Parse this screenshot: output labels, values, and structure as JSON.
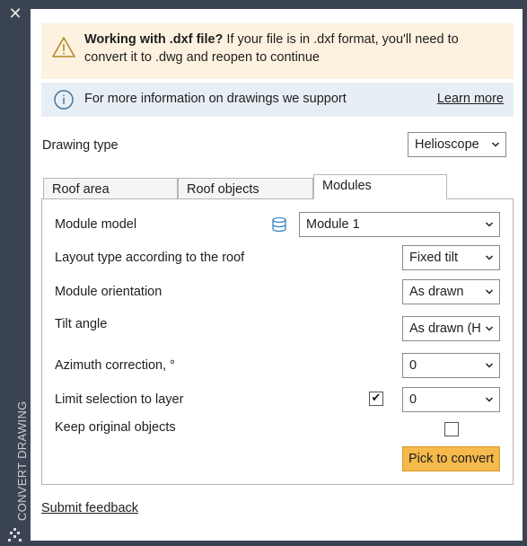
{
  "window": {
    "close_glyph": "✕",
    "vertical_title": "CONVERT DRAWING"
  },
  "warning": {
    "bold": "Working with .dxf file?",
    "text": " If your file is in .dxf format, you'll need to convert it to .dwg and reopen to continue",
    "icon": "warning-triangle-icon",
    "color": "#fdf2df"
  },
  "info": {
    "text": "For more information on drawings we support",
    "link": "Learn more",
    "icon": "info-circle-icon"
  },
  "drawing_type": {
    "label": "Drawing type",
    "value": "Helioscope"
  },
  "tabs": [
    {
      "label": "Roof area",
      "active": false
    },
    {
      "label": "Roof objects",
      "active": false
    },
    {
      "label": "Modules",
      "active": true
    }
  ],
  "fields": {
    "module_model": {
      "label": "Module model",
      "value": "Module 1"
    },
    "layout_type": {
      "label": "Layout type according to the roof",
      "value": "Fixed tilt"
    },
    "orientation": {
      "label": "Module orientation",
      "value": "As drawn"
    },
    "tilt": {
      "label": "Tilt angle",
      "value": "As drawn (H"
    },
    "azimuth": {
      "label": "Azimuth correction, °",
      "value": "0"
    },
    "limit_layer": {
      "label": "Limit selection to layer",
      "value": "0",
      "checked": true,
      "check_glyph": "✔"
    },
    "keep_original": {
      "label": "Keep original objects",
      "checked": false
    }
  },
  "actions": {
    "pick_label": "Pick to convert",
    "pick_color": "#f6b94b"
  },
  "footer": {
    "feedback": "Submit feedback"
  }
}
